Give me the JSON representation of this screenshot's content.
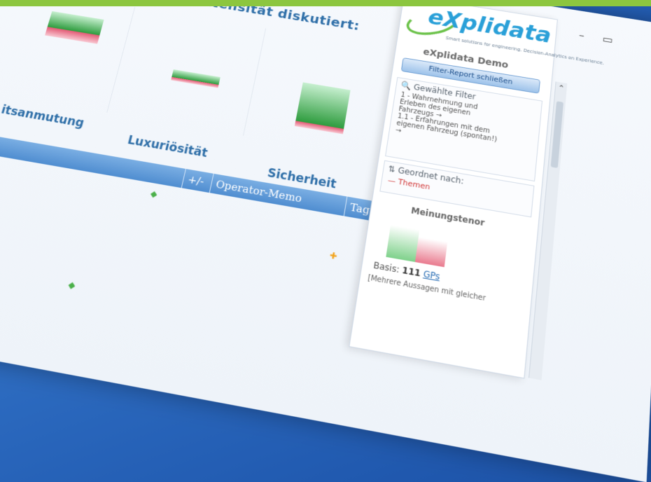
{
  "report": {
    "heading": "ellung in u.s. Intensität diskutiert:",
    "categories": [
      "itsanmutung",
      "Luxuriösität",
      "Sicherheit"
    ],
    "table_headers": [
      "+/-",
      "Operator-Memo",
      "Tagit"
    ]
  },
  "colors": {
    "top_bar": "#8cc63f",
    "positive": "#2e9c3e",
    "negative": "#e35a75",
    "accent": "#4f8dd0"
  },
  "sidebar": {
    "logo_text": "eXplidata",
    "tagline": "Smart solutions for engineering. Decision-Analytics on Experience.",
    "title": "eXplidata Demo",
    "close_button": "Filter-Report schließen",
    "filter_section": {
      "title": "Gewählte Filter",
      "lines": [
        "1 - Wahrnehmung und",
        "Erleben des eigenen",
        "Fahrzeugs →",
        "1.1 - Erfahrungen mit dem",
        "eigenen Fahrzeug (spontan!)",
        "→"
      ]
    },
    "sort_section": {
      "title": "Geordnet nach:",
      "value": "Themen"
    },
    "tenor": {
      "title": "Meinungstenor",
      "basis_label": "Basis:",
      "basis_value": "111",
      "basis_unit": "GPs",
      "note": "[Mehrere Aussagen mit gleicher"
    }
  },
  "window": {
    "minimize_icon": "minimize-icon",
    "maximize_icon": "maximize-icon"
  }
}
